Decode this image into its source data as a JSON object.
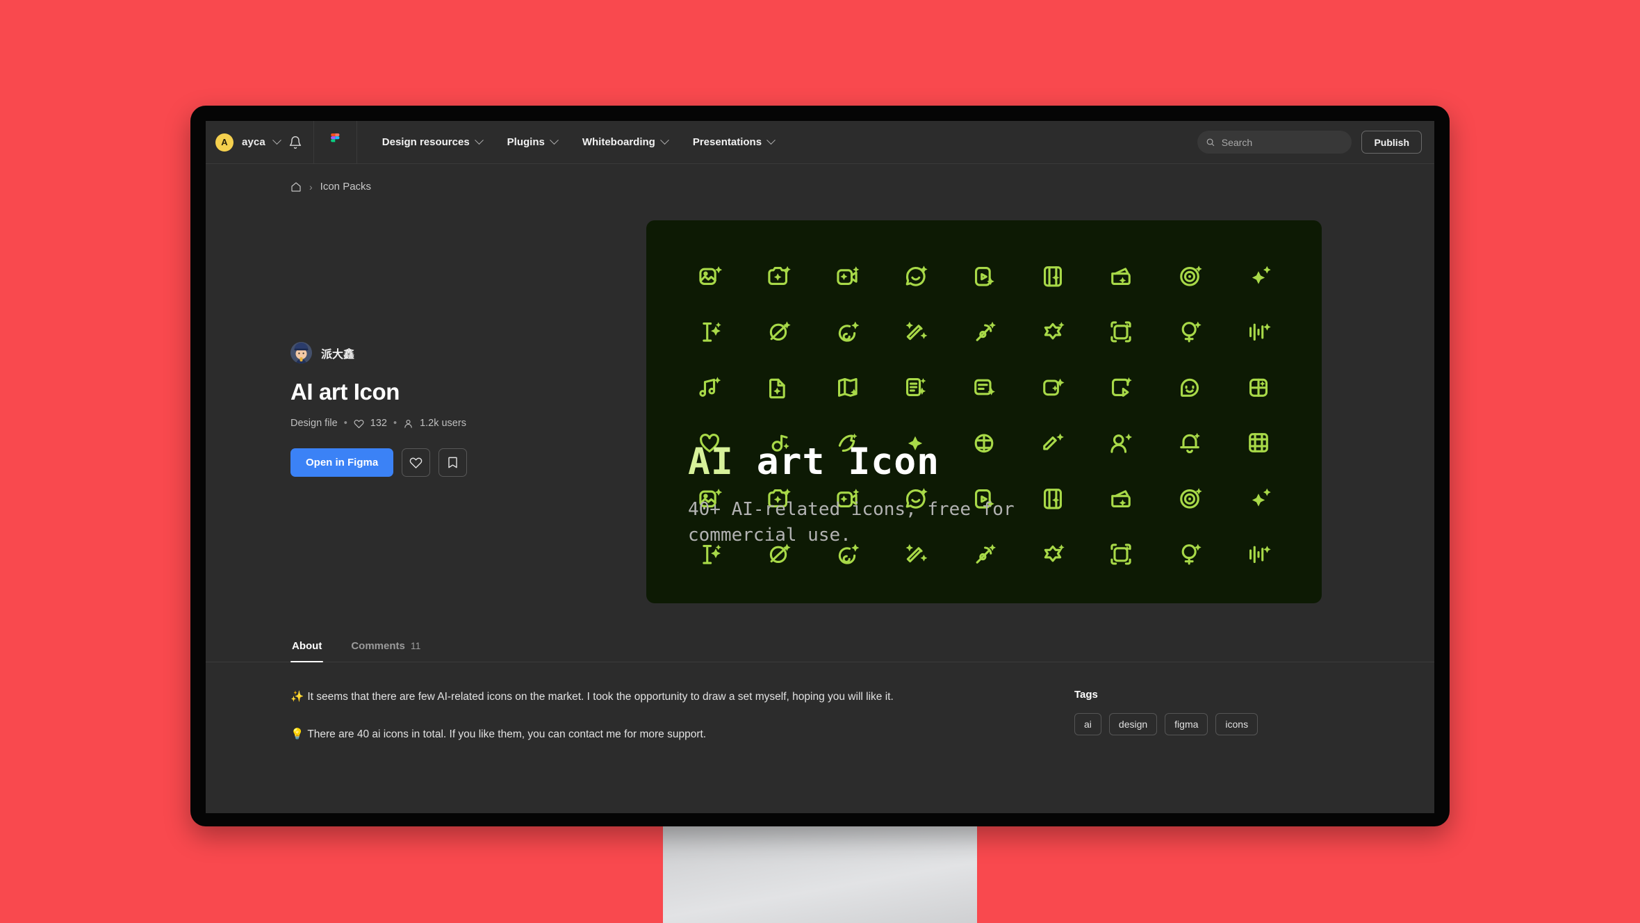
{
  "background_color": "#F9494E",
  "topbar": {
    "user": {
      "initial": "A",
      "name": "ayca"
    },
    "notifications_icon": "bell-icon",
    "brand_icon": "figma-logo-icon",
    "nav": [
      {
        "label": "Design resources"
      },
      {
        "label": "Plugins"
      },
      {
        "label": "Whiteboarding"
      },
      {
        "label": "Presentations"
      }
    ],
    "search": {
      "placeholder": "Search",
      "value": ""
    },
    "publish_label": "Publish"
  },
  "breadcrumb": {
    "home_icon": "home-icon",
    "separator": "›",
    "current": "Icon Packs"
  },
  "hero": {
    "author": "派大鑫",
    "title": "AI art Icon",
    "meta": {
      "type": "Design file",
      "likes": "132",
      "users": "1.2k users",
      "dot": "•"
    },
    "open_label": "Open in Figma",
    "like_icon": "heart-icon",
    "save_icon": "bookmark-icon",
    "accent_blue": "#3B82F6"
  },
  "preview": {
    "card_background": "#0D1A04",
    "icon_color": "#A8D948",
    "promo_title_primary": "AI",
    "promo_title_secondary": " art Icon",
    "promo_subtitle": "40+ AI-related icons, free for commercial use."
  },
  "tabs": [
    {
      "label": "About",
      "count": "",
      "active": true
    },
    {
      "label": "Comments",
      "count": "11",
      "active": false
    }
  ],
  "about": {
    "paragraphs": [
      {
        "emoji": "✨",
        "text": "It seems that there are few AI-related icons on the market. I took the opportunity to draw a set myself, hoping you will like it."
      },
      {
        "emoji": "💡",
        "text": "There are 40 ai icons in total. If you like them, you can contact me for more support."
      }
    ]
  },
  "tags": {
    "title": "Tags",
    "items": [
      "ai",
      "design",
      "figma",
      "icons"
    ]
  }
}
